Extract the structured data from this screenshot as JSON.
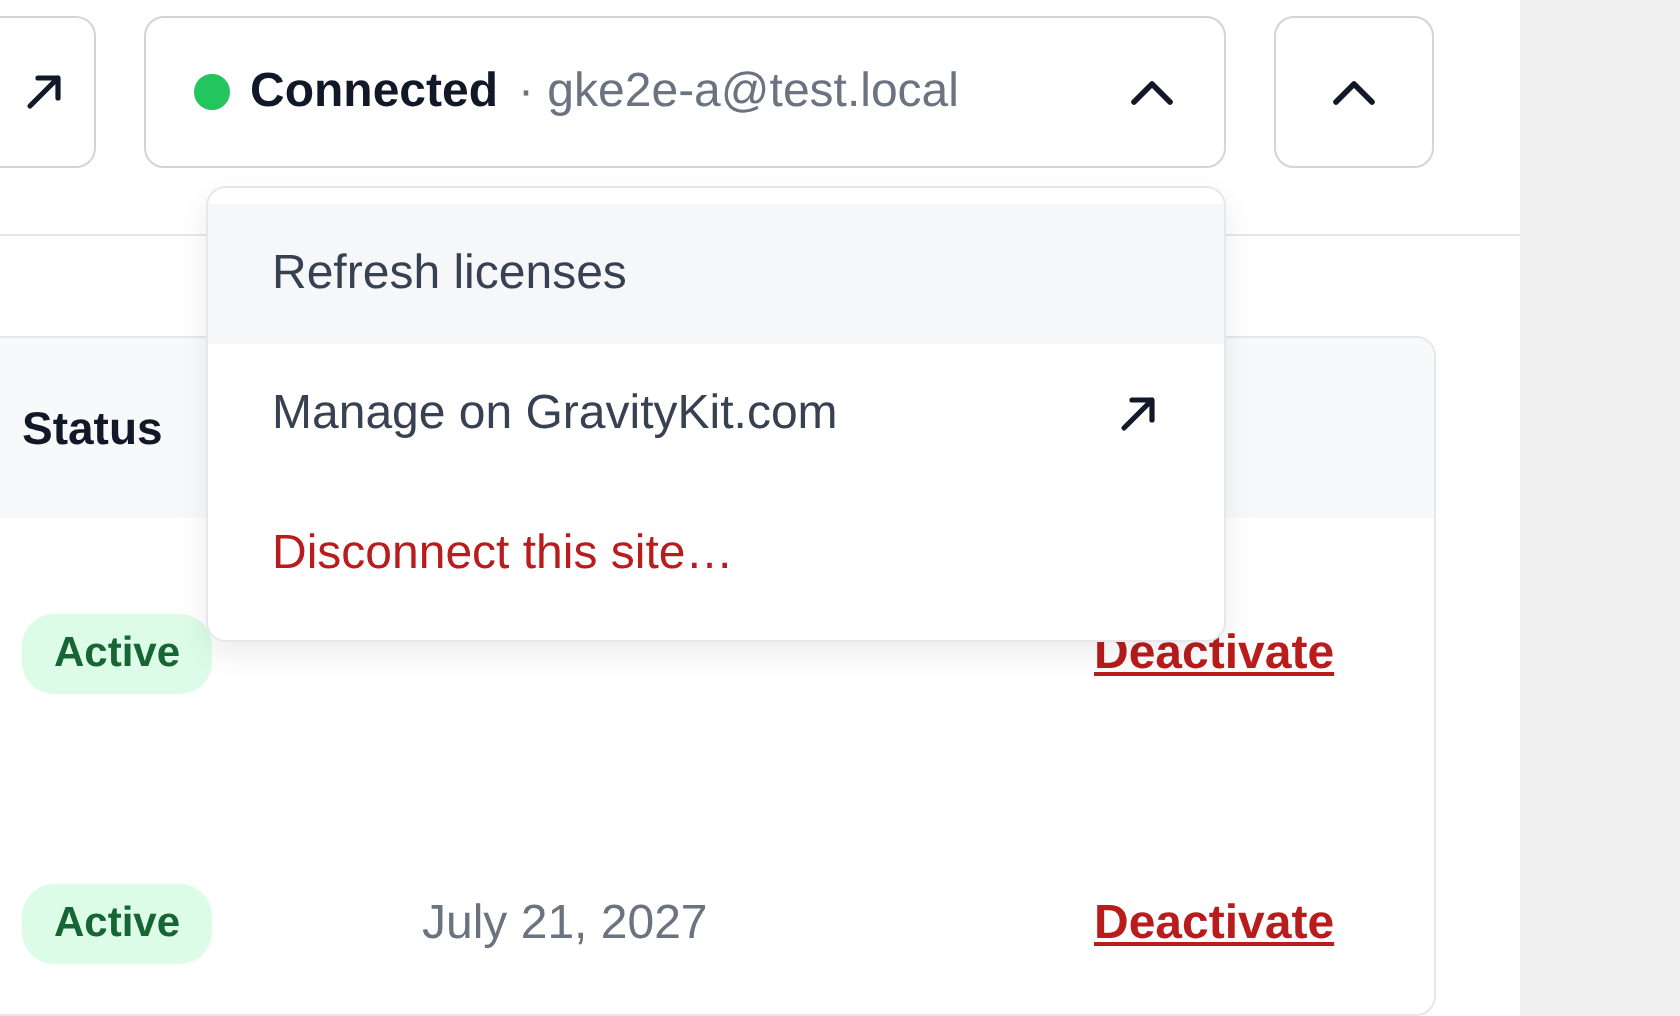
{
  "toolbar": {
    "connection": {
      "status": "Connected",
      "connected": true,
      "account": "· gke2e-a@test.local",
      "expanded": true
    }
  },
  "menu": {
    "items": [
      {
        "label": "Refresh licenses",
        "kind": "plain",
        "highlighted": true
      },
      {
        "label": "Manage on GravityKit.com",
        "kind": "external",
        "highlighted": false
      },
      {
        "label": "Disconnect this site…",
        "kind": "danger",
        "highlighted": false
      }
    ]
  },
  "table": {
    "columns": [
      "Status"
    ],
    "rows": [
      {
        "status": "Active",
        "action": "Deactivate"
      },
      {
        "status": "Active",
        "expires": "July 21, 2027",
        "action": "Deactivate"
      }
    ]
  }
}
